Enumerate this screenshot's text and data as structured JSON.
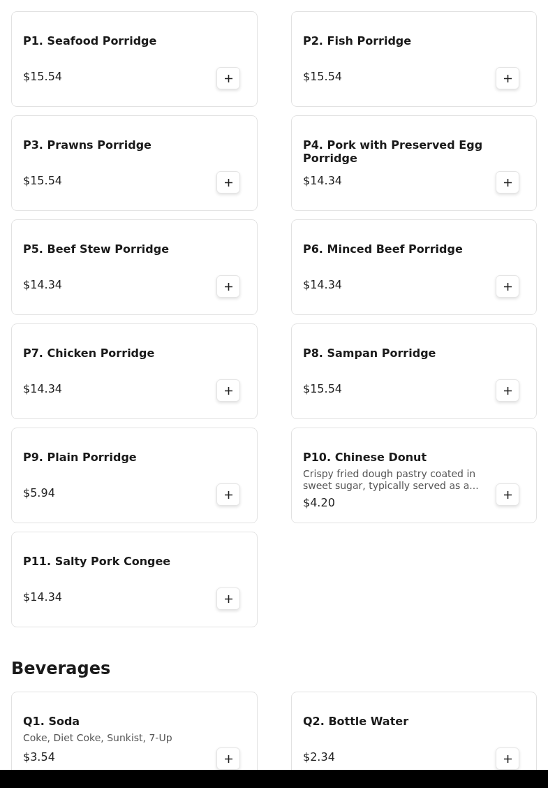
{
  "sections": [
    {
      "items": [
        {
          "name": "P1. Seafood Porridge",
          "price": "$15.54"
        },
        {
          "name": "P2. Fish Porridge",
          "price": "$15.54"
        },
        {
          "name": "P3. Prawns Porridge",
          "price": "$15.54"
        },
        {
          "name": "P4. Pork with Preserved Egg Porridge",
          "price": "$14.34"
        },
        {
          "name": "P5. Beef Stew Porridge",
          "price": "$14.34"
        },
        {
          "name": "P6. Minced Beef Porridge",
          "price": "$14.34"
        },
        {
          "name": "P7. Chicken Porridge",
          "price": "$14.34"
        },
        {
          "name": "P8. Sampan Porridge",
          "price": "$15.54"
        },
        {
          "name": "P9. Plain Porridge",
          "price": "$5.94"
        },
        {
          "name": "P10. Chinese Donut",
          "description": "Crispy fried dough pastry coated in sweet sugar, typically served as a...",
          "price": "$4.20"
        },
        {
          "name": "P11. Salty Pork Congee",
          "price": "$14.34"
        }
      ]
    },
    {
      "title": "Beverages",
      "items": [
        {
          "name": "Q1. Soda",
          "description": "Coke, Diet Coke, Sunkist, 7-Up",
          "price": "$3.54"
        },
        {
          "name": "Q2. Bottle Water",
          "price": "$2.34"
        }
      ]
    }
  ]
}
